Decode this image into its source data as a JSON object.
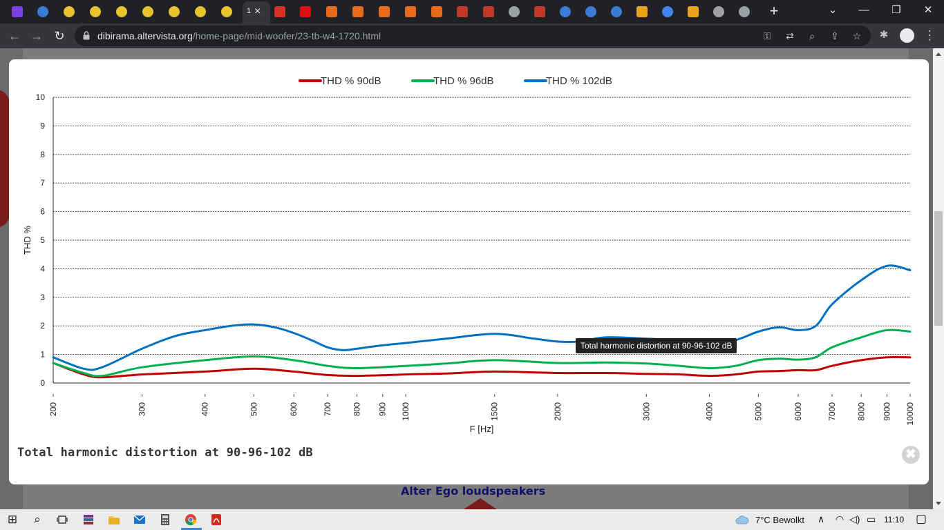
{
  "browser": {
    "active_tab_title": "1",
    "url_host": "dibirama.altervista.org",
    "url_path": "/home-page/mid-woofer/23-tb-w4-1720.html",
    "new_tab_glyph": "+",
    "tab_close_glyph": "×"
  },
  "tabs": [
    {
      "icon": "purple-chevron-icon",
      "color": "#7b3fe4"
    },
    {
      "icon": "wave-logo-icon",
      "color": "#3a7bd5"
    },
    {
      "icon": "color-wheel-icon",
      "color": "#e8c32e"
    },
    {
      "icon": "color-wheel-icon",
      "color": "#e8c32e"
    },
    {
      "icon": "color-wheel-icon",
      "color": "#e8c32e"
    },
    {
      "icon": "color-wheel-icon",
      "color": "#e8c32e"
    },
    {
      "icon": "color-wheel-icon",
      "color": "#e8c32e"
    },
    {
      "icon": "color-wheel-icon",
      "color": "#e8c32e"
    },
    {
      "icon": "color-wheel-icon",
      "color": "#e8c32e"
    },
    {
      "icon": "pdf-icon",
      "color": "#d93025"
    },
    {
      "icon": "red-triangle-icon",
      "color": "#e01010"
    },
    {
      "icon": "star-logo-icon",
      "color": "#e86a1c"
    },
    {
      "icon": "star-logo-icon",
      "color": "#e86a1c"
    },
    {
      "icon": "star-logo-icon",
      "color": "#e86a1c"
    },
    {
      "icon": "star-logo-icon",
      "color": "#e86a1c"
    },
    {
      "icon": "star-logo-icon",
      "color": "#e86a1c"
    },
    {
      "icon": "red-wave-icon",
      "color": "#c0392b"
    },
    {
      "icon": "red-wave-icon",
      "color": "#c0392b"
    },
    {
      "icon": "globe-icon",
      "color": "#9aa0a6"
    },
    {
      "icon": "red-wave-icon",
      "color": "#c0392b"
    },
    {
      "icon": "wave-logo-icon",
      "color": "#3a7bd5"
    },
    {
      "icon": "wave-logo-icon",
      "color": "#3a7bd5"
    },
    {
      "icon": "wave-logo-icon",
      "color": "#3a7bd5"
    },
    {
      "icon": "striped-logo-icon",
      "color": "#e8a21c"
    },
    {
      "icon": "google-icon",
      "color": "#4285f4"
    },
    {
      "icon": "pencil-icon",
      "color": "#e8a21c"
    },
    {
      "icon": "globe-icon",
      "color": "#9aa0a6"
    },
    {
      "icon": "globe-icon",
      "color": "#9aa0a6"
    }
  ],
  "window_controls": {
    "minimize": "—",
    "restore": "❐",
    "close": "✕",
    "tab_search": "⌄"
  },
  "toolbar_glyphs": {
    "back": "←",
    "forward": "→",
    "reload": "↻",
    "key": "⚿",
    "translate": "⇄",
    "zoom": "⌕",
    "share": "⇪",
    "bookmark": "☆",
    "extensions": "✱",
    "menu": "⋮"
  },
  "page": {
    "footer_text": "Alter Ego loudspeakers"
  },
  "lightbox": {
    "caption": "Total harmonic distortion at 90-96-102 dB",
    "tooltip": "Total harmonic distortion at 90-96-102 dB",
    "close_glyph": "✖"
  },
  "chart_data": {
    "type": "line",
    "title": "",
    "xlabel": "F [Hz]",
    "ylabel": "THD %",
    "xscale": "log",
    "xlim": [
      200,
      10000
    ],
    "ylim": [
      0,
      10
    ],
    "grid": true,
    "legend_position": "top-center",
    "x_ticks": [
      200,
      300,
      400,
      500,
      600,
      700,
      800,
      900,
      1000,
      1500,
      2000,
      3000,
      4000,
      5000,
      6000,
      7000,
      8000,
      9000,
      10000
    ],
    "y_ticks": [
      0,
      1,
      2,
      3,
      4,
      5,
      6,
      7,
      8,
      9,
      10
    ],
    "series": [
      {
        "name": "THD % 90dB",
        "color": "#c00000",
        "x": [
          200,
          230,
          250,
          300,
          400,
          500,
          600,
          700,
          800,
          1000,
          1200,
          1500,
          2000,
          2500,
          3000,
          3500,
          4000,
          4500,
          5000,
          5500,
          6000,
          6500,
          7000,
          8000,
          9000,
          10000
        ],
        "y": [
          0.7,
          0.3,
          0.2,
          0.3,
          0.4,
          0.5,
          0.4,
          0.28,
          0.25,
          0.3,
          0.33,
          0.4,
          0.35,
          0.35,
          0.32,
          0.3,
          0.25,
          0.3,
          0.4,
          0.42,
          0.45,
          0.45,
          0.6,
          0.8,
          0.9,
          0.9
        ]
      },
      {
        "name": "THD % 96dB",
        "color": "#00b050",
        "x": [
          200,
          230,
          250,
          300,
          400,
          500,
          600,
          700,
          800,
          1000,
          1200,
          1500,
          2000,
          2500,
          3000,
          3500,
          4000,
          4500,
          5000,
          5500,
          6000,
          6500,
          7000,
          8000,
          9000,
          10000
        ],
        "y": [
          0.7,
          0.35,
          0.25,
          0.55,
          0.8,
          0.93,
          0.8,
          0.6,
          0.52,
          0.6,
          0.68,
          0.8,
          0.7,
          0.72,
          0.68,
          0.6,
          0.52,
          0.6,
          0.8,
          0.85,
          0.82,
          0.9,
          1.25,
          1.6,
          1.85,
          1.8
        ]
      },
      {
        "name": "THD % 102dB",
        "color": "#0070c0",
        "x": [
          200,
          230,
          250,
          300,
          350,
          400,
          450,
          500,
          550,
          600,
          650,
          700,
          750,
          800,
          900,
          1000,
          1200,
          1500,
          1800,
          2000,
          2200,
          2500,
          3000,
          3500,
          4000,
          4500,
          5000,
          5500,
          6000,
          6500,
          7000,
          8000,
          9000,
          10000
        ],
        "y": [
          0.9,
          0.5,
          0.55,
          1.2,
          1.65,
          1.85,
          2.0,
          2.05,
          1.95,
          1.75,
          1.5,
          1.25,
          1.15,
          1.2,
          1.32,
          1.4,
          1.55,
          1.72,
          1.55,
          1.45,
          1.45,
          1.6,
          1.55,
          1.5,
          1.4,
          1.5,
          1.8,
          1.95,
          1.85,
          2.0,
          2.75,
          3.6,
          4.1,
          3.95
        ]
      }
    ]
  },
  "taskbar": {
    "start_glyph": "⊞",
    "search_glyph": "⌕",
    "weather": "7°C  Bewolkt",
    "time": "11:10",
    "tray_caret": "∧",
    "tray_wifi": "◠",
    "tray_volume": "◁)",
    "tray_battery": "▭",
    "notification": "▢"
  }
}
